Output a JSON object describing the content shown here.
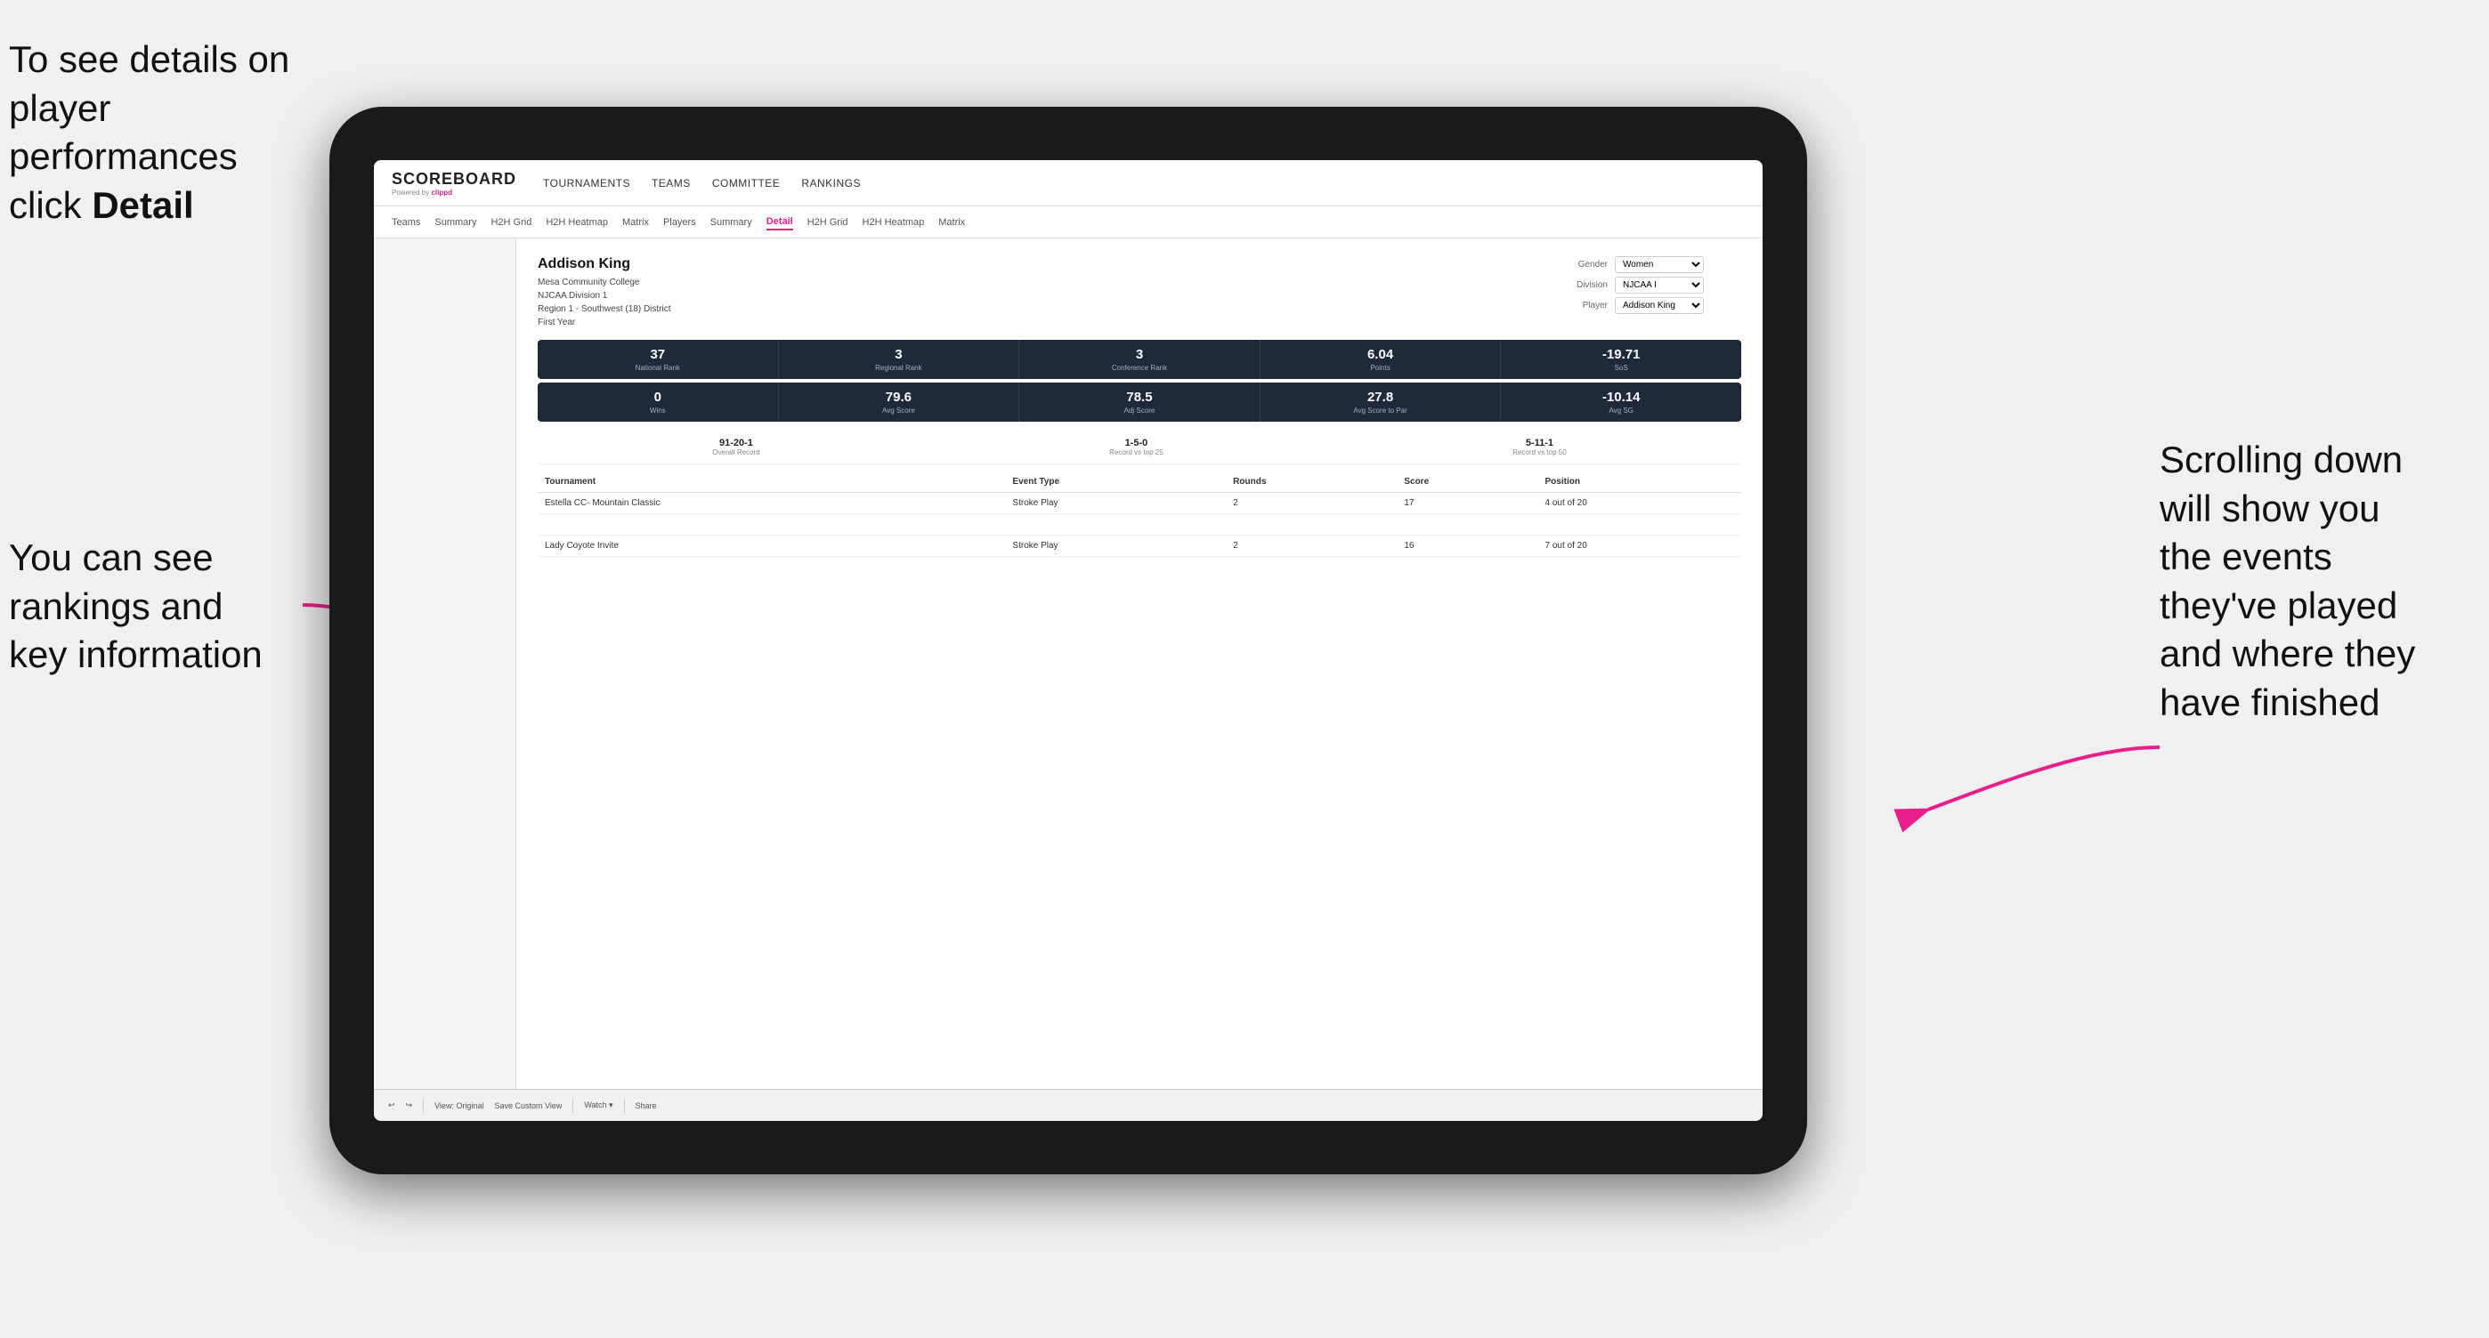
{
  "annotations": {
    "top_left": "To see details on player performances click",
    "top_left_bold": "Detail",
    "bottom_left_line1": "You can see",
    "bottom_left_line2": "rankings and",
    "bottom_left_line3": "key information",
    "right_line1": "Scrolling down",
    "right_line2": "will show you",
    "right_line3": "the events",
    "right_line4": "they've played",
    "right_line5": "and where they",
    "right_line6": "have finished"
  },
  "header": {
    "logo": "SCOREBOARD",
    "powered_by": "Powered by",
    "clippd": "clippd",
    "nav": [
      "TOURNAMENTS",
      "TEAMS",
      "COMMITTEE",
      "RANKINGS"
    ]
  },
  "sub_nav": {
    "items": [
      "Teams",
      "Summary",
      "H2H Grid",
      "H2H Heatmap",
      "Matrix",
      "Players",
      "Summary",
      "Detail",
      "H2H Grid",
      "H2H Heatmap",
      "Matrix"
    ],
    "active": "Detail"
  },
  "player": {
    "name": "Addison King",
    "college": "Mesa Community College",
    "division": "NJCAA Division 1",
    "region": "Region 1 - Southwest (18) District",
    "year": "First Year"
  },
  "selectors": {
    "gender_label": "Gender",
    "gender_value": "Women",
    "division_label": "Division",
    "division_value": "NJCAA I",
    "player_label": "Player",
    "player_value": "Addison King"
  },
  "stats_row1": [
    {
      "value": "37",
      "label": "National Rank"
    },
    {
      "value": "3",
      "label": "Regional Rank"
    },
    {
      "value": "3",
      "label": "Conference Rank"
    },
    {
      "value": "6.04",
      "label": "Points"
    },
    {
      "value": "-19.71",
      "label": "SoS"
    }
  ],
  "stats_row2": [
    {
      "value": "0",
      "label": "Wins"
    },
    {
      "value": "79.6",
      "label": "Avg Score"
    },
    {
      "value": "78.5",
      "label": "Adj Score"
    },
    {
      "value": "27.8",
      "label": "Avg Score to Par"
    },
    {
      "value": "-10.14",
      "label": "Avg SG"
    }
  ],
  "records": [
    {
      "value": "91-20-1",
      "label": "Overall Record"
    },
    {
      "value": "1-5-0",
      "label": "Record vs top 25"
    },
    {
      "value": "5-11-1",
      "label": "Record vs top 50"
    }
  ],
  "table": {
    "headers": [
      "Tournament",
      "Event Type",
      "Rounds",
      "Score",
      "Position"
    ],
    "rows": [
      {
        "tournament": "Estella CC- Mountain Classic",
        "event_type": "Stroke Play",
        "rounds": "2",
        "score": "17",
        "position": "4 out of 20"
      },
      {
        "tournament": "",
        "event_type": "",
        "rounds": "",
        "score": "",
        "position": ""
      },
      {
        "tournament": "Lady Coyote Invite",
        "event_type": "Stroke Play",
        "rounds": "2",
        "score": "16",
        "position": "7 out of 20"
      }
    ]
  },
  "toolbar": {
    "buttons": [
      "View: Original",
      "Save Custom View",
      "Watch ▾",
      "Share"
    ]
  }
}
